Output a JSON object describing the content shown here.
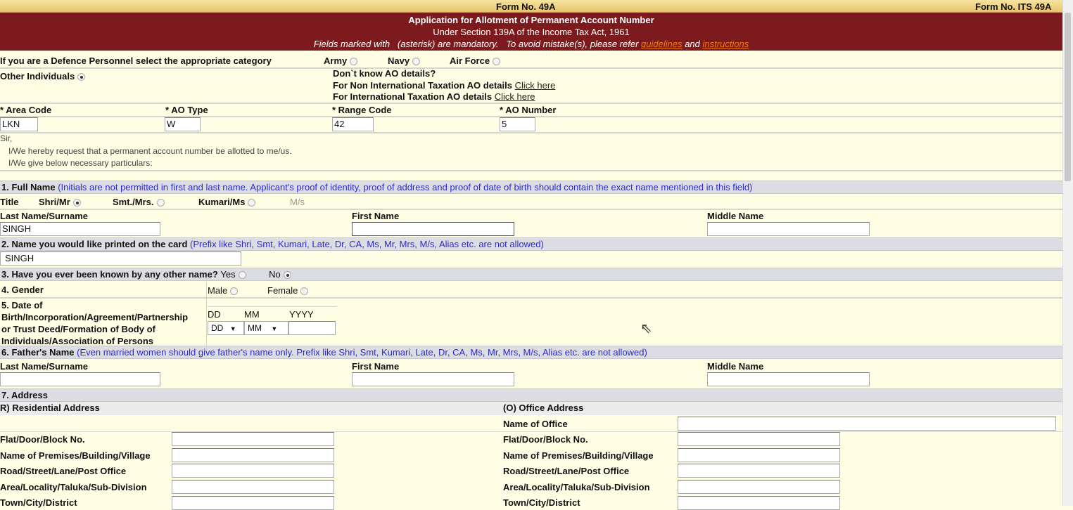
{
  "header": {
    "form_no": "Form No. 49A",
    "form_no_its": "Form No. ITS 49A"
  },
  "banner": {
    "title": "Application for Allotment of Permanent Account Number",
    "subtitle": "Under Section 139A of the Income Tax Act, 1961",
    "note_prefix": "Fields marked with",
    "note_asterisk": "(asterisk) are mandatory.",
    "note_mid": "To avoid mistake(s), please refer",
    "guidelines": "guidelines",
    "and": "and",
    "instructions": "instructions"
  },
  "defence": {
    "label": "If you are a Defence Personnel select the appropriate category",
    "options": [
      "Army",
      "Navy",
      "Air Force"
    ],
    "other": "Other Individuals"
  },
  "ao_help": {
    "q": "Don`t know AO details?",
    "non_intl": "For Non International Taxation AO details",
    "intl": "For International Taxation AO details",
    "click": "Click here"
  },
  "ao": {
    "area_code_label": "Area Code",
    "area_code": "LKN",
    "ao_type_label": "AO Type",
    "ao_type": "W",
    "range_code_label": "Range Code",
    "range_code": "42",
    "ao_number_label": "AO Number",
    "ao_number": "5"
  },
  "letter": {
    "sir": "Sir,",
    "line1": "I/We hereby request that a permanent account number be allotted to me/us.",
    "line2": "I/We give below necessary particulars:"
  },
  "s1": {
    "title": "1. Full Name",
    "note": "(Initials are not permitted in first and last name. Applicant's proof of identity, proof of address and proof of date of birth should contain the exact name mentioned in this field)",
    "title_label": "Title",
    "titles": [
      "Shri/Mr",
      "Smt./Mrs.",
      "Kumari/Ms",
      "M/s"
    ],
    "last": "Last Name/Surname",
    "first": "First Name",
    "middle": "Middle Name",
    "last_value": "SINGH"
  },
  "s2": {
    "title": "2. Name you would like printed on the card",
    "note": "(Prefix like Shri, Smt, Kumari, Late, Dr, CA, Ms, Mr, Mrs, M/s, Alias etc. are not allowed)",
    "value": "SINGH"
  },
  "s3": {
    "title": "3. Have you ever been known by any other name?",
    "yes": "Yes",
    "no": "No"
  },
  "s4": {
    "title": "4. Gender",
    "male": "Male",
    "female": "Female"
  },
  "s5": {
    "l1": "5. Date of",
    "l2": "Birth/Incorporation/Agreement/Partnership",
    "l3": "or Trust Deed/Formation of Body of",
    "l4": "Individuals/Association of Persons",
    "dd": "DD",
    "mm": "MM",
    "yyyy": "YYYY",
    "dd_sel": "DD",
    "mm_sel": "MM"
  },
  "s6": {
    "title": "6. Father's Name",
    "note": "(Even married women should give father's name only. Prefix like Shri, Smt, Kumari, Late, Dr, CA, Ms, Mr, Mrs, M/s, Alias etc. are not allowed)",
    "last": "Last Name/Surname",
    "first": "First Name",
    "middle": "Middle Name"
  },
  "s7": {
    "title": "7. Address",
    "res": "R) Residential Address",
    "off": "(O) Office Address",
    "name_of_office": "Name of Office",
    "fields": [
      "Flat/Door/Block No.",
      "Name of Premises/Building/Village",
      "Road/Street/Lane/Post Office",
      "Area/Locality/Taluka/Sub-Division",
      "Town/City/District"
    ]
  }
}
